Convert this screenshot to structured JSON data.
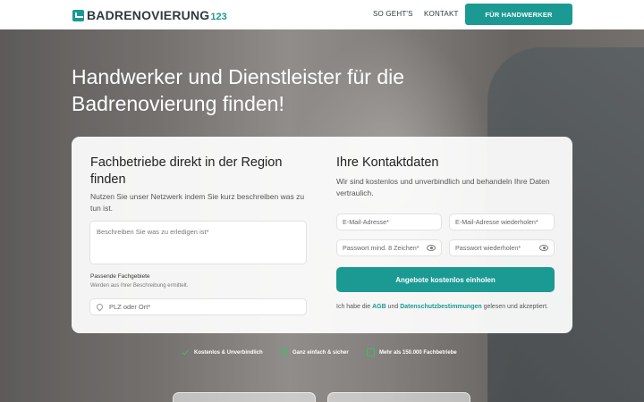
{
  "header": {
    "logo_text": "BADRENOVIERUNG",
    "logo_num": "123",
    "nav": [
      "SO GEHT'S",
      "KONTAKT"
    ],
    "cta": "FÜR HANDWERKER"
  },
  "hero": {
    "title": "Handwerker und Dienstleister für die Badrenovierung finden!"
  },
  "form": {
    "left": {
      "title": "Fachbetriebe direkt in der Region finden",
      "desc": "Nutzen Sie unser Netzwerk indem Sie kurz beschreiben was zu tun ist.",
      "textarea_placeholder": "Beschreiben Sie was zu erledigen ist*",
      "fields_label": "Passende Fachgebiete",
      "fields_sub": "Werden aus Ihrer Beschreibung ermittelt.",
      "plz_placeholder": "PLZ oder Ort*"
    },
    "right": {
      "title": "Ihre Kontaktdaten",
      "desc": "Wir sind kostenlos und unverbindlich und behandeln Ihre Daten vertraulich.",
      "email": "E-Mail-Adresse*",
      "email_repeat": "E-Mail-Adresse wiederholen*",
      "password": "Passwort mind. 8 Zeichen*",
      "password_repeat": "Passwort wiederholen*",
      "submit": "Angebote kostenlos einholen",
      "consent_pre": "Ich habe die ",
      "consent_agb": "AGB",
      "consent_mid": " und ",
      "consent_privacy": "Datenschutzbestimmungen",
      "consent_post": " gelesen und akzeptiert."
    }
  },
  "features": [
    "Kostenlos & Unverbindlich",
    "Ganz einfach & sicher",
    "Mehr als 150.000 Fachbetriebe"
  ],
  "colors": {
    "accent": "#1a9a93",
    "check": "#38c06a"
  },
  "icons": {
    "check": "check-icon",
    "shield": "shield-icon",
    "building": "building-icon",
    "location": "location-pin-icon",
    "eye": "eye-icon"
  }
}
